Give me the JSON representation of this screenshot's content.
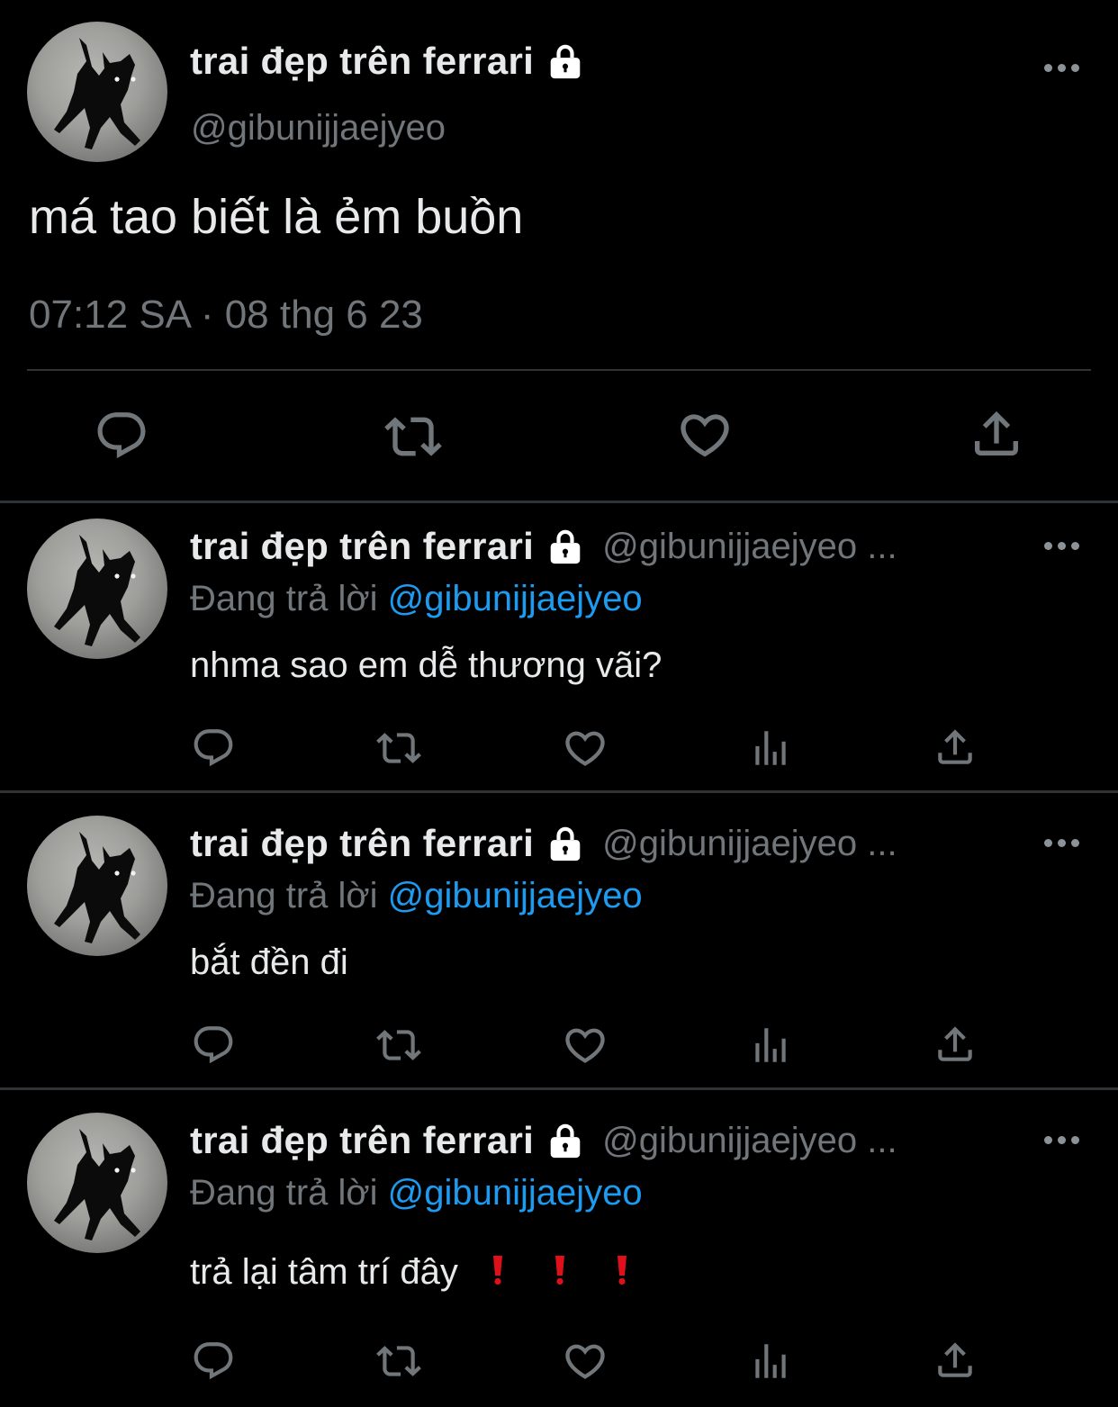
{
  "account": {
    "display_name": "trai đẹp trên ferrari",
    "handle": "@gibunijjaejyeo",
    "handle_truncated": "@gibunijjaejyeo ..."
  },
  "main_tweet": {
    "text": "má tao biết là ẻm buồn",
    "timestamp": "07:12 SA · 08 thg 6 23"
  },
  "replies": [
    {
      "replying_label": "Đang trả lời",
      "mention": "@gibunijjaejyeo",
      "text": "nhma sao em dễ thương vãi?"
    },
    {
      "replying_label": "Đang trả lời",
      "mention": "@gibunijjaejyeo",
      "text": "bắt đền đi"
    },
    {
      "replying_label": "Đang trả lời",
      "mention": "@gibunijjaejyeo",
      "text": "trả lại tâm trí đây",
      "emoji_count": 3
    }
  ],
  "icons": {
    "reply": "reply-icon",
    "retweet": "retweet-icon",
    "like": "like-icon",
    "views": "views-icon",
    "share": "share-icon",
    "more": "more-icon",
    "lock": "lock-icon"
  },
  "colors": {
    "background": "#000000",
    "text": "#e7e9ea",
    "muted": "#71767b",
    "link": "#1d9bf0",
    "divider": "#2f3336",
    "emoji_red": "#e0101b"
  }
}
